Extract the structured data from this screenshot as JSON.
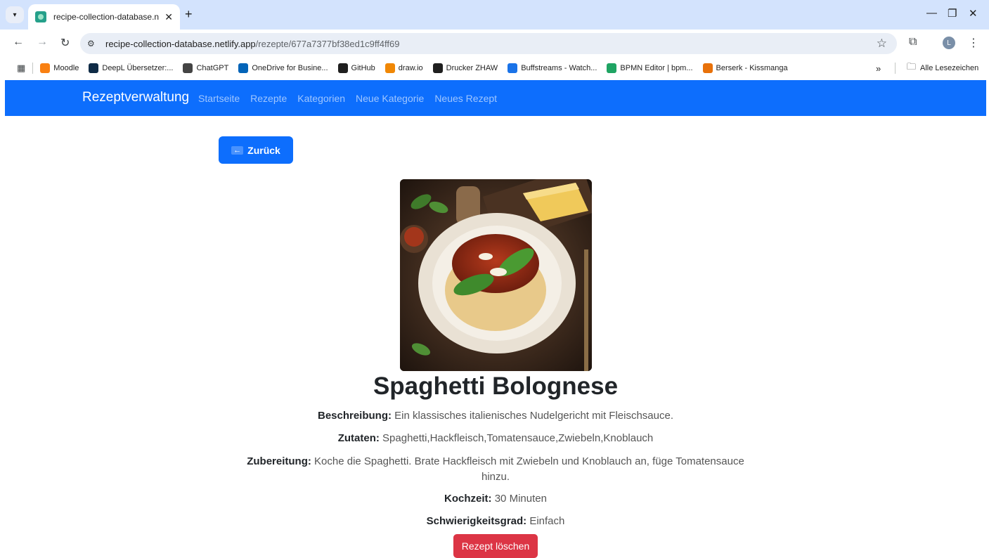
{
  "browser": {
    "tab_title": "recipe-collection-database.netli",
    "url_host": "recipe-collection-database.netlify.app",
    "url_path": "/rezepte/677a7377bf38ed1c9ff4ff69",
    "profile_initial": "L",
    "bookmarks": [
      {
        "label": "Moodle",
        "icon": "moodle-icon",
        "color": "#f98012"
      },
      {
        "label": "DeepL Übersetzer:...",
        "icon": "deepl-icon",
        "color": "#0f2b46"
      },
      {
        "label": "ChatGPT",
        "icon": "chatgpt-icon",
        "color": "#444"
      },
      {
        "label": "OneDrive for Busine...",
        "icon": "onedrive-icon",
        "color": "#0364b8"
      },
      {
        "label": "GitHub",
        "icon": "github-icon",
        "color": "#1f1f1f"
      },
      {
        "label": "draw.io",
        "icon": "drawio-icon",
        "color": "#f08705"
      },
      {
        "label": "Drucker ZHAW",
        "icon": "printer-icon",
        "color": "#1f1f1f"
      },
      {
        "label": "Buffstreams - Watch...",
        "icon": "star-icon",
        "color": "#1a73e8"
      },
      {
        "label": "BPMN Editor | bpm...",
        "icon": "bpmn-icon",
        "color": "#1fa463"
      },
      {
        "label": "Berserk - Kissmanga",
        "icon": "kissmanga-icon",
        "color": "#e8710a"
      }
    ],
    "overflow_label": "»",
    "all_bookmarks_label": "Alle Lesezeichen"
  },
  "navbar": {
    "brand": "Rezeptverwaltung",
    "links": [
      "Startseite",
      "Rezepte",
      "Kategorien",
      "Neue Kategorie",
      "Neues Rezept"
    ]
  },
  "recipe": {
    "back_label": "Zurück",
    "title": "Spaghetti Bolognese",
    "description_label": "Beschreibung:",
    "description": "Ein klassisches italienisches Nudelgericht mit Fleischsauce.",
    "ingredients_label": "Zutaten:",
    "ingredients": "Spaghetti,Hackfleisch,Tomatensauce,Zwiebeln,Knoblauch",
    "preparation_label": "Zubereitung:",
    "preparation": "Koche die Spaghetti. Brate Hackfleisch mit Zwiebeln und Knoblauch an, füge Tomatensauce hinzu.",
    "cooktime_label": "Kochzeit:",
    "cooktime": "30 Minuten",
    "difficulty_label": "Schwierigkeitsgrad:",
    "difficulty": "Einfach",
    "delete_label": "Rezept löschen"
  },
  "colors": {
    "primary": "#0d6efd",
    "danger": "#dc3545"
  }
}
